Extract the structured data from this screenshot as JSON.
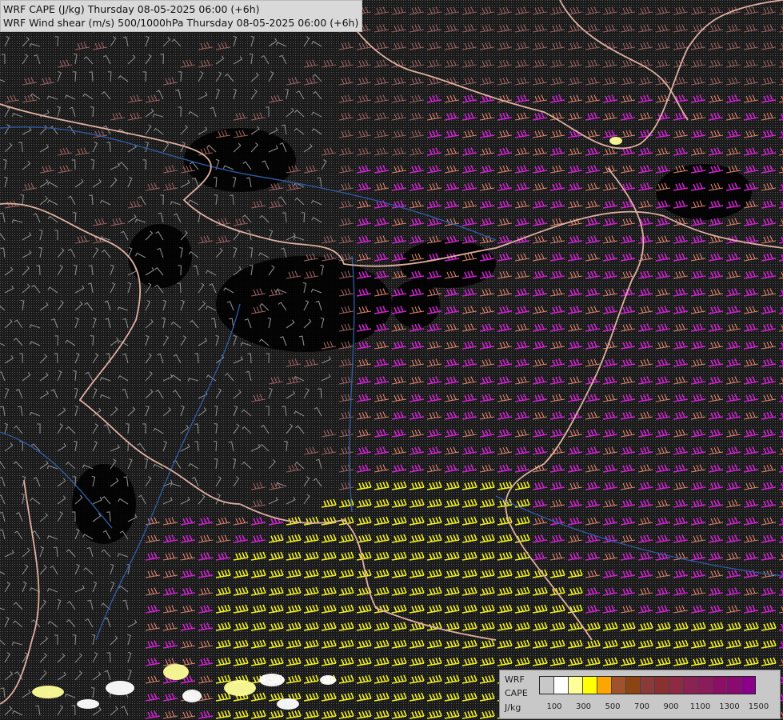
{
  "title": {
    "line1": "WRF CAPE (J/kg) Thursday 08-05-2025 06:00 (+6h)",
    "line2": "WRF Wind shear (m/s) 500/1000hPa Thursday 08-05-2025 06:00 (+6h)"
  },
  "legend": {
    "label_wrf": "WRF",
    "label_cape": "CAPE",
    "label_units": "J/kg",
    "colors": [
      "#c8c8c8",
      "#ffffff",
      "#ffff99",
      "#ffff00",
      "#ffa500",
      "#a0522d",
      "#8b4513",
      "#8b3a3a",
      "#8b3030",
      "#8f2a45",
      "#8b2252",
      "#8b1c5a",
      "#8b1065",
      "#8b0a6e",
      "#8b008b"
    ],
    "ticks": [
      "100",
      "300",
      "500",
      "700",
      "900",
      "1100",
      "1300",
      "1500"
    ]
  },
  "map_layers": {
    "barb_colors": {
      "calm": "#8a8a8a",
      "low": "#9b6060",
      "moderate": "#e08070",
      "strong": "#cc22cc",
      "very_strong": "#f0f020"
    },
    "border_color": "#e0b0a0",
    "river_color": "#3060b0",
    "cape_patch_color": "#ffffff"
  }
}
